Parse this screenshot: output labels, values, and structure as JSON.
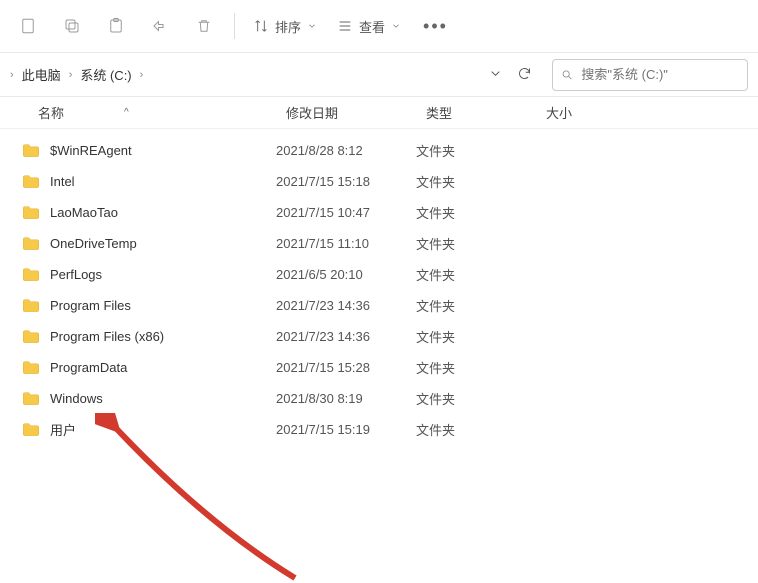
{
  "toolbar": {
    "sort_label": "排序",
    "view_label": "查看"
  },
  "breadcrumb": {
    "items": [
      "",
      "此电脑",
      "系统 (C:)"
    ]
  },
  "search": {
    "placeholder": "搜索\"系统 (C:)\""
  },
  "columns": {
    "name": "名称",
    "date": "修改日期",
    "type": "类型",
    "size": "大小"
  },
  "rows": [
    {
      "name": "$WinREAgent",
      "date": "2021/8/28 8:12",
      "type": "文件夹"
    },
    {
      "name": "Intel",
      "date": "2021/7/15 15:18",
      "type": "文件夹"
    },
    {
      "name": "LaoMaoTao",
      "date": "2021/7/15 10:47",
      "type": "文件夹"
    },
    {
      "name": "OneDriveTemp",
      "date": "2021/7/15 11:10",
      "type": "文件夹"
    },
    {
      "name": "PerfLogs",
      "date": "2021/6/5 20:10",
      "type": "文件夹"
    },
    {
      "name": "Program Files",
      "date": "2021/7/23 14:36",
      "type": "文件夹"
    },
    {
      "name": "Program Files (x86)",
      "date": "2021/7/23 14:36",
      "type": "文件夹"
    },
    {
      "name": "ProgramData",
      "date": "2021/7/15 15:28",
      "type": "文件夹"
    },
    {
      "name": "Windows",
      "date": "2021/8/30 8:19",
      "type": "文件夹"
    },
    {
      "name": "用户",
      "date": "2021/7/15 15:19",
      "type": "文件夹"
    }
  ]
}
